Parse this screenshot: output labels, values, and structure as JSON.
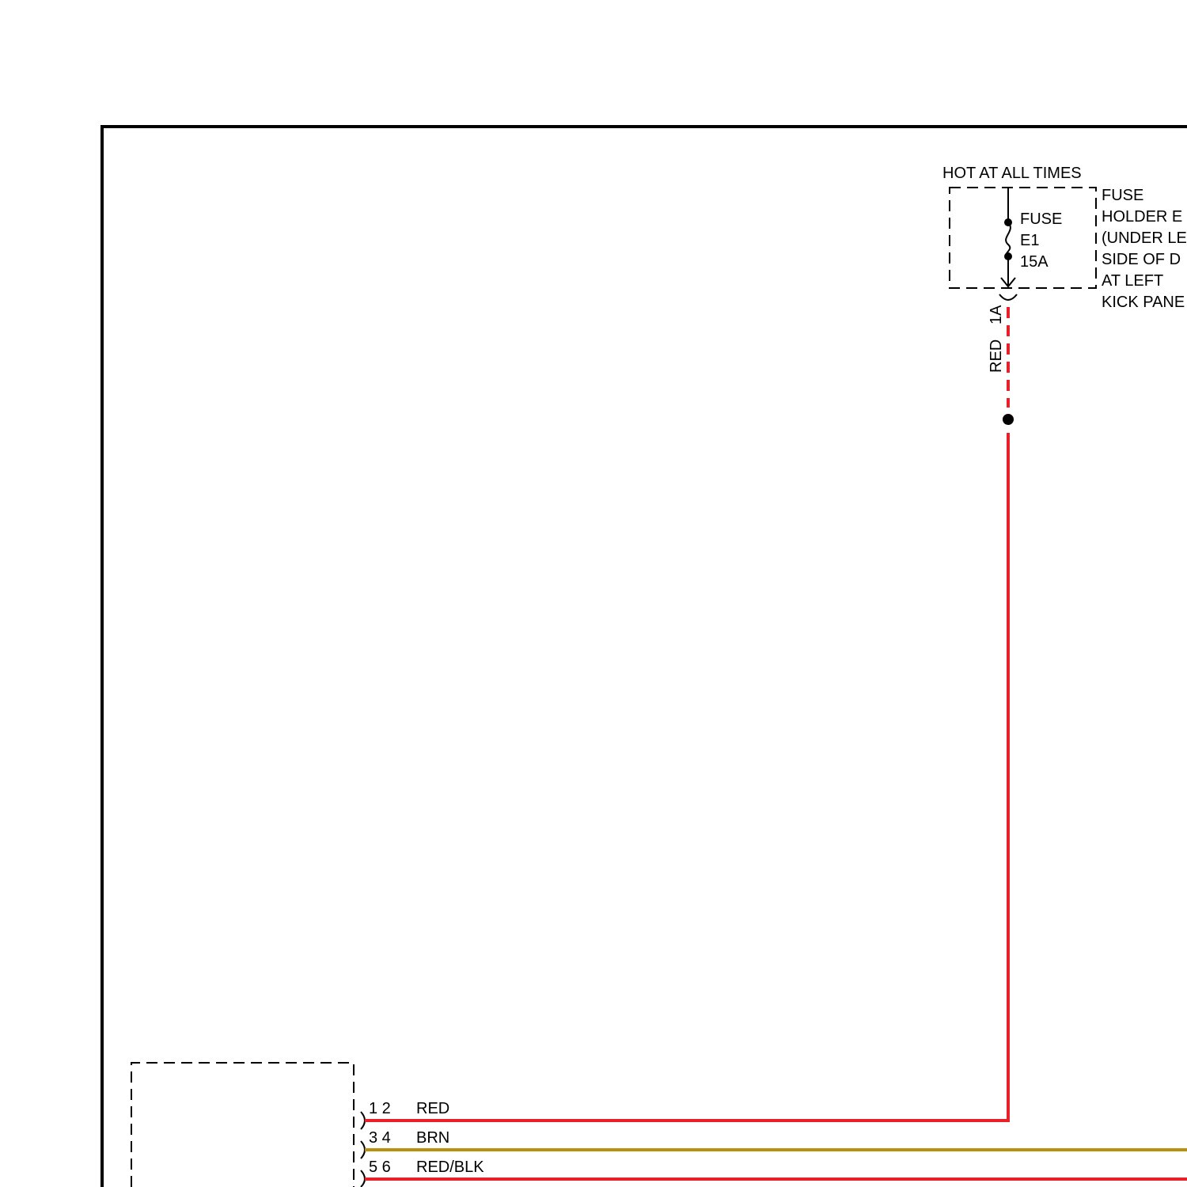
{
  "power_label": "HOT AT ALL TIMES",
  "fuse": {
    "line1": "FUSE",
    "line2": "E1",
    "rating": "15A"
  },
  "fuse_holder": {
    "line1": "FUSE",
    "line2": "HOLDER E",
    "line3": "(UNDER LE",
    "line4": "SIDE OF D",
    "line5": "AT LEFT",
    "line6": "KICK PANE"
  },
  "vertical_wire": {
    "terminal": "1A",
    "color_label": "RED"
  },
  "connector_rows": [
    {
      "pins": "1 2",
      "color_label": "RED",
      "wire_color": "#e8202a"
    },
    {
      "pins": "3 4",
      "color_label": "BRN",
      "wire_color": "#b8900c"
    },
    {
      "pins": "5 6",
      "color_label": "RED/BLK",
      "wire_color": "#e8202a"
    }
  ],
  "colors": {
    "red_wire": "#e8202a",
    "brown_wire": "#b8900c",
    "outline": "#000000"
  }
}
